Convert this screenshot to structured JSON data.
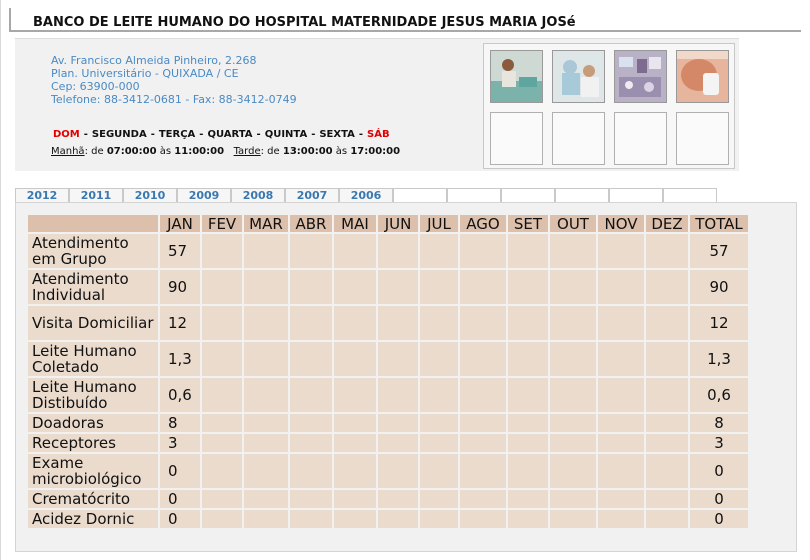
{
  "header": {
    "title": "BANCO DE LEITE HUMANO DO HOSPITAL MATERNIDADE JESUS MARIA JOSé"
  },
  "contact": {
    "address": "Av. Francisco Almeida Pinheiro, 2.268",
    "district": "Plan. Universitário - QUIXADA / CE",
    "cep": "Cep: 63900-000",
    "phones": "Telefone: 88-3412-0681 - Fax: 88-3412-0749"
  },
  "schedule": {
    "days": [
      {
        "label": "DOM",
        "weekend": true
      },
      {
        "label": "SEGUNDA",
        "weekend": false
      },
      {
        "label": "TERÇA",
        "weekend": false
      },
      {
        "label": "QUARTA",
        "weekend": false
      },
      {
        "label": "QUINTA",
        "weekend": false
      },
      {
        "label": "SEXTA",
        "weekend": false
      },
      {
        "label": "SÁB",
        "weekend": true
      }
    ],
    "separator": "-",
    "morning_label": "Manhã",
    "morning_hours": "07:00:00",
    "afternoon_label": "Tarde",
    "afternoon_hours": "13:00:00",
    "morning_end": "11:00:00",
    "afternoon_end": "17:00:00",
    "de": "de",
    "as": "às"
  },
  "year_tabs": [
    "2012",
    "2011",
    "2010",
    "2009",
    "2008",
    "2007",
    "2006",
    "",
    "",
    "",
    "",
    "",
    ""
  ],
  "table": {
    "columns": [
      "",
      "JAN",
      "FEV",
      "MAR",
      "ABR",
      "MAI",
      "JUN",
      "JUL",
      "AGO",
      "SET",
      "OUT",
      "NOV",
      "DEZ",
      "TOTAL"
    ],
    "rows": [
      {
        "label": "Atendimento em Grupo",
        "jan": "57",
        "total": "57"
      },
      {
        "label": "Atendimento Individual",
        "jan": "90",
        "total": "90"
      },
      {
        "label": "Visita Domiciliar",
        "jan": "12",
        "total": "12"
      },
      {
        "label": "Leite Humano Coletado",
        "jan": "1,3",
        "total": "1,3"
      },
      {
        "label": "Leite Humano Distibuído",
        "jan": "0,6",
        "total": "0,6"
      },
      {
        "label": "Doadoras",
        "jan": "8",
        "total": "8"
      },
      {
        "label": "Receptores",
        "jan": "3",
        "total": "3"
      },
      {
        "label": "Exame microbiológico",
        "jan": "0",
        "total": "0"
      },
      {
        "label": "Crematócrito",
        "jan": "0",
        "total": "0"
      },
      {
        "label": "Acidez Dornic",
        "jan": "0",
        "total": "0"
      }
    ]
  },
  "photos": {
    "count_filled": 4,
    "count_empty": 4
  }
}
